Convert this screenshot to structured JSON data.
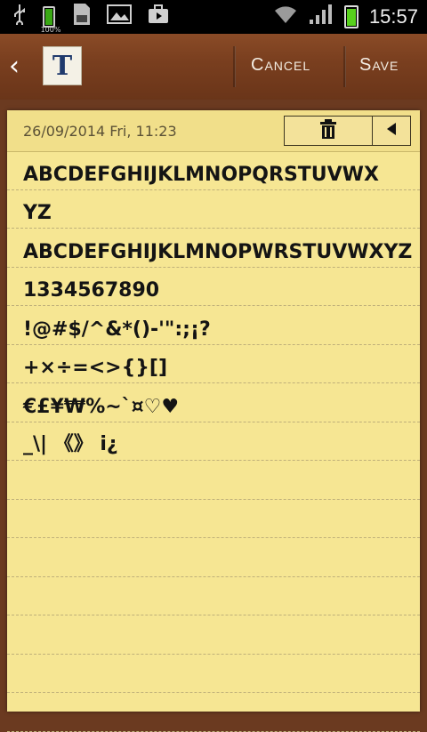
{
  "status_bar": {
    "time": "15:57",
    "battery_small_label": "100%",
    "icons": [
      "usb-icon",
      "battery-icon",
      "sd-card-icon",
      "image-icon",
      "briefcase-icon",
      "wifi-icon",
      "signal-icon",
      "battery-icon"
    ]
  },
  "toolbar": {
    "app_icon_letter": "T",
    "cancel_label": "Cancel",
    "save_label": "Save"
  },
  "note": {
    "date": "26/09/2014 Fri, 11:23",
    "lines": [
      "ABCDEFGHIJKLMNOPQRSTUVWX",
      "YZ",
      "ABCDEFGHIJKLMNOPWRSTUVWXYZ",
      "1334567890",
      "!@#$/^&*()-'\":;¡?",
      "+×÷=<>{}[]",
      "€£¥₩%~`¤♡♥",
      "_\\| 《》 i¿",
      "",
      "",
      "",
      "",
      "",
      "",
      ""
    ]
  }
}
